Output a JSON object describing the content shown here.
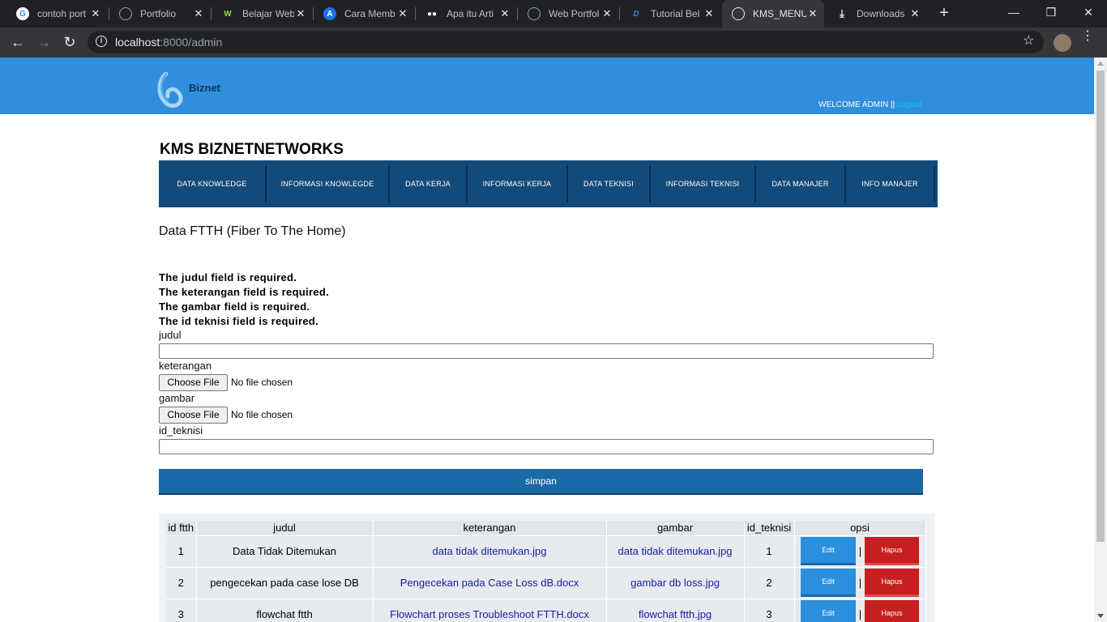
{
  "browser": {
    "tabs": [
      {
        "title": "contoh port",
        "icon": "google-icon"
      },
      {
        "title": "Portfolio",
        "icon": "globe-icon"
      },
      {
        "title": "Belajar Web",
        "icon": "w-icon"
      },
      {
        "title": "Cara Memb",
        "icon": "a-icon"
      },
      {
        "title": "Apa itu Arti",
        "icon": "medium-icon"
      },
      {
        "title": "Web Portfol",
        "icon": "globe-icon"
      },
      {
        "title": "Tutorial Bel",
        "icon": "d-icon"
      },
      {
        "title": "KMS_MENU",
        "icon": "globe-icon"
      },
      {
        "title": "Downloads",
        "icon": "download-icon"
      }
    ],
    "active_tab": 7,
    "url_host": "localhost",
    "url_rest": ":8000/admin"
  },
  "header": {
    "logo_text": "Biznet",
    "welcome": "WELCOME ADMIN ||",
    "logout": "Logout"
  },
  "site_title": "KMS BIZNETNETWORKS",
  "menu": [
    "DATA KNOWLEDGE",
    "INFORMASI KNOWLEGDE",
    "DATA KERJA",
    "INFORMASI KERJA",
    "DATA TEKNISI",
    "INFORMASI TEKNISI",
    "DATA MANAJER",
    "INFO MANAJER"
  ],
  "section_title": "Data FTTH (Fiber To The Home)",
  "errors": [
    "The judul field is required.",
    "The keterangan field is required.",
    "The gambar field is required.",
    "The id teknisi field is required."
  ],
  "form": {
    "judul_label": "judul",
    "keterangan_label": "keterangan",
    "gambar_label": "gambar",
    "id_teknisi_label": "id_teknisi",
    "choose_file": "Choose File",
    "no_file": "No file chosen",
    "submit": "simpan"
  },
  "table": {
    "headers": [
      "id ftth",
      "judul",
      "keterangan",
      "gambar",
      "id_teknisi",
      "opsi"
    ],
    "rows": [
      {
        "id": "1",
        "judul": "Data Tidak Ditemukan",
        "keterangan": "data tidak ditemukan.jpg",
        "gambar": "data tidak ditemukan.jpg",
        "id_teknisi": "1"
      },
      {
        "id": "2",
        "judul": "pengecekan pada case lose DB",
        "keterangan": "Pengecekan pada Case Loss dB.docx",
        "gambar": "gambar db loss.jpg",
        "id_teknisi": "2"
      },
      {
        "id": "3",
        "judul": "flowchat ftth",
        "keterangan": "Flowchart proses Troubleshoot FTTH.docx",
        "gambar": "flowchat ftth.jpg",
        "id_teknisi": "3"
      }
    ],
    "edit_label": "Edit",
    "hapus_label": "Hapus",
    "separator": "|"
  }
}
